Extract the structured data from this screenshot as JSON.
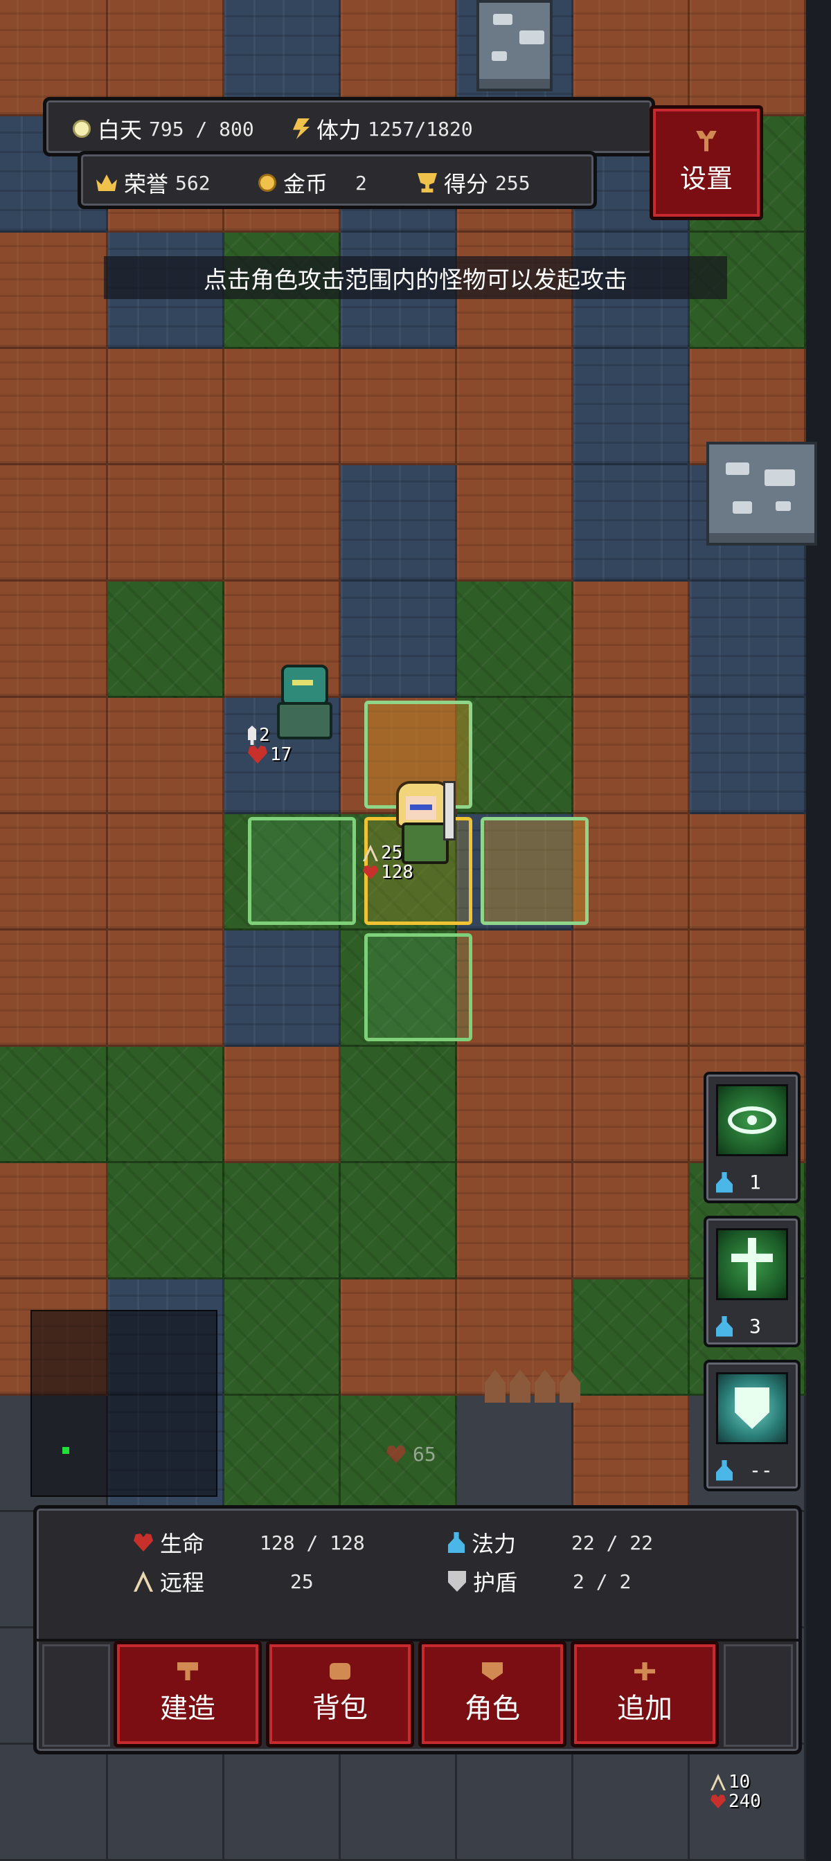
{
  "top_hud": {
    "day_label": "白天",
    "day_value": "795 / 800",
    "stamina_label": "体力",
    "stamina_value": "1257/1820",
    "honor_label": "荣誉",
    "honor_value": "562",
    "gold_label": "金币",
    "gold_value": "2",
    "score_label": "得分",
    "score_value": "255",
    "settings_label": "设置"
  },
  "hint": "点击角色攻击范围内的怪物可以发起攻击",
  "player": {
    "attack": "25",
    "hp": "128"
  },
  "enemy": {
    "attack": "2",
    "hp": "17"
  },
  "ghost_hp": "65",
  "skills": [
    {
      "name": "eye-skill",
      "cost": "1"
    },
    {
      "name": "cross-skill",
      "cost": "3"
    },
    {
      "name": "shield-skill",
      "cost": "--"
    }
  ],
  "stats": {
    "hp_label": "生命",
    "hp_value": "128 / 128",
    "mana_label": "法力",
    "mana_value": "22  /  22",
    "ranged_label": "远程",
    "ranged_value": "25",
    "shield_label": "护盾",
    "shield_value": "2  /  2"
  },
  "actions": {
    "build": "建造",
    "bag": "背包",
    "character": "角色",
    "add": "追加"
  },
  "corner_unit": {
    "attack": "10",
    "hp": "240"
  }
}
